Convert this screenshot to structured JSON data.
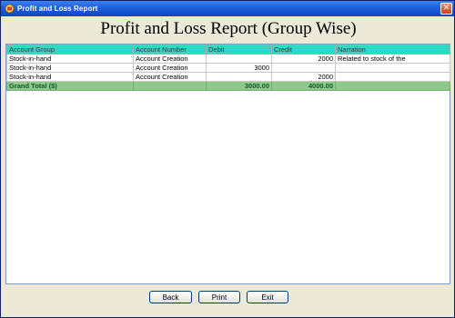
{
  "window": {
    "title": "Profit and Loss Report",
    "close_glyph": "✕"
  },
  "report": {
    "heading": "Profit and Loss Report (Group Wise)"
  },
  "table": {
    "columns": [
      "Account Group",
      "Account Number",
      "Debit",
      "Credit",
      "Narration"
    ],
    "rows": [
      {
        "group": "Stock-in-hand",
        "account": "Account Creation",
        "debit": "",
        "credit": "2000",
        "narration": "Related to stock of the"
      },
      {
        "group": "Stock-in-hand",
        "account": "Account Creation",
        "debit": "3000",
        "credit": "",
        "narration": ""
      },
      {
        "group": "Stock-in-hand",
        "account": "Account Creation",
        "debit": "",
        "credit": "2000",
        "narration": ""
      }
    ],
    "total": {
      "label": "Grand Total ($)",
      "account": "",
      "debit": "3000.00",
      "credit": "4000.00",
      "narration": ""
    }
  },
  "buttons": {
    "back": "Back",
    "print": "Print",
    "exit": "Exit"
  },
  "icons": {
    "app": "app-icon",
    "close": "close-icon"
  },
  "colors": {
    "header_bg": "#33d6c5",
    "total_bg": "#8fc98a",
    "titlebar": "#1f5fd6",
    "window_bg": "#ece9d8"
  }
}
